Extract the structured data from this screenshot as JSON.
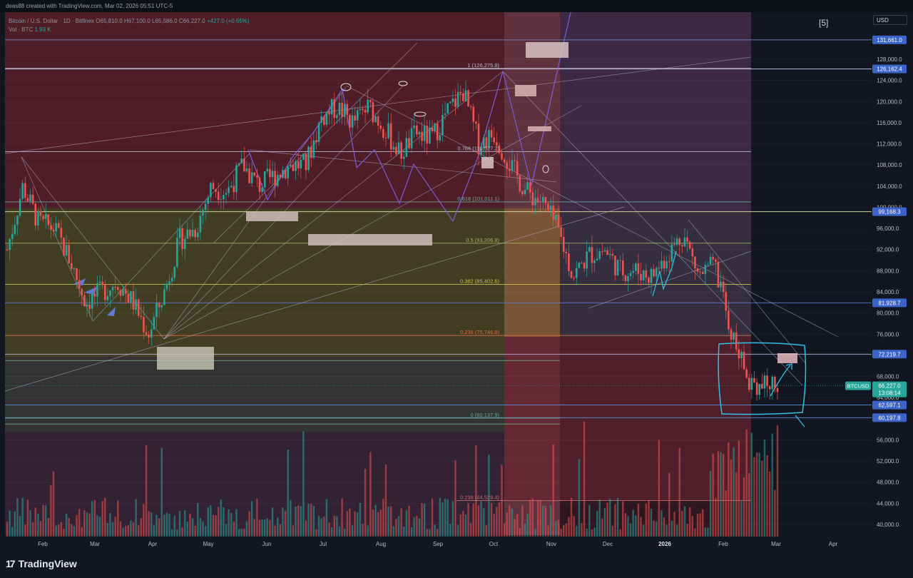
{
  "header": {
    "created_by": "deas88 created with TradingView.com, Mar 02, 2026 05:51 UTC-5"
  },
  "legend": {
    "symbol": "Bitcoin / U.S. Dollar · 1D · Bitfinex",
    "ohlc": "O65,810.0  H67,100.0  L65,586.0  C66,227.0",
    "change": "+427.0 (+0.65%)",
    "vol_label": "Vol · BTC",
    "vol_value": "1.93 K"
  },
  "badge": "[5]",
  "currency": "USD",
  "brand": {
    "icon": "tradingview-logo-icon",
    "name": "TradingView"
  },
  "colors": {
    "up": "#26a69a",
    "down": "#ef5350",
    "accent": "#2962ff",
    "price_badge": "#26a69a"
  },
  "chart_data": {
    "type": "candlestick",
    "symbol": "BTCUSD",
    "x_ticks": [
      "Feb",
      "Mar",
      "Apr",
      "May",
      "Jun",
      "Jul",
      "Aug",
      "Sep",
      "Oct",
      "Nov",
      "Dec",
      "2026",
      "Feb",
      "Mar",
      "Apr"
    ],
    "y_ticks": [
      128000,
      124000,
      120000,
      116000,
      112000,
      108000,
      104000,
      100000,
      96000,
      92000,
      88000,
      84000,
      80000,
      76000,
      72000,
      68000,
      64000,
      60000,
      56000,
      52000,
      48000,
      44000,
      40000
    ],
    "y_tick_labels": [
      "128,000.0",
      "124,000.0",
      "120,000.0",
      "116,000.0",
      "112,000.0",
      "108,000.0",
      "104,000.0",
      "100,000.0",
      "96,000.0",
      "92,000.0",
      "88,000.0",
      "84,000.0",
      "80,000.0",
      "76,000.0",
      "72,000.0",
      "68,000.0",
      "64,000.0",
      "60,000.0",
      "56,000.0",
      "52,000.0",
      "48,000.0",
      "44,000.0",
      "40,000.0"
    ],
    "price_badges": [
      {
        "label": "131,661.0",
        "value": 131661
      },
      {
        "label": "126,162.4",
        "value": 126162
      },
      {
        "label": "99,168.3",
        "value": 99168
      },
      {
        "label": "81,928.7",
        "value": 81929
      },
      {
        "label": "72,219.7",
        "value": 72220
      },
      {
        "label": "62,597.1",
        "value": 62597
      },
      {
        "label": "60,197.8",
        "value": 60198
      }
    ],
    "current": {
      "symbol": "BTCUSD",
      "price": "66,227.0",
      "countdown": "13:08:14",
      "value": 66227
    },
    "fib_levels": [
      {
        "label": "1 (126,275.8)",
        "value": 126276
      },
      {
        "label": "0.786 (110,527.2)",
        "value": 110527
      },
      {
        "label": "0.618 (101,011.1)",
        "value": 101011
      },
      {
        "label": "0.5 (93,206.8)",
        "value": 93207
      },
      {
        "label": "0.382 (85,402.6)",
        "value": 85403
      },
      {
        "label": "0.236 (75,746.8)",
        "value": 75747
      },
      {
        "label": "0 (60,137.9)",
        "value": 60138
      },
      {
        "label": "0.236 (44,529.4)",
        "value": 44529
      }
    ],
    "price_path": [
      [
        0,
        92000
      ],
      [
        1,
        104000
      ],
      [
        2,
        97000
      ],
      [
        3,
        96000
      ],
      [
        4,
        90000
      ],
      [
        5,
        82000
      ],
      [
        6,
        84000
      ],
      [
        7,
        86000
      ],
      [
        8,
        82000
      ],
      [
        9,
        76000
      ],
      [
        10,
        84000
      ],
      [
        11,
        94000
      ],
      [
        12,
        96000
      ],
      [
        13,
        104000
      ],
      [
        14,
        103000
      ],
      [
        15,
        108000
      ],
      [
        16,
        104000
      ],
      [
        17,
        106000
      ],
      [
        18,
        108000
      ],
      [
        19,
        108000
      ],
      [
        20,
        117000
      ],
      [
        21,
        119000
      ],
      [
        22,
        116000
      ],
      [
        23,
        119000
      ],
      [
        24,
        115000
      ],
      [
        25,
        110000
      ],
      [
        26,
        114000
      ],
      [
        27,
        113000
      ],
      [
        28,
        118000
      ],
      [
        29,
        122000
      ],
      [
        30,
        112000
      ],
      [
        31,
        114000
      ],
      [
        32,
        108000
      ],
      [
        33,
        103000
      ],
      [
        34,
        101000
      ],
      [
        35,
        96000
      ],
      [
        36,
        87000
      ],
      [
        37,
        91000
      ],
      [
        38,
        92000
      ],
      [
        39,
        88000
      ],
      [
        40,
        88000
      ],
      [
        41,
        87000
      ],
      [
        42,
        91000
      ],
      [
        43,
        95000
      ],
      [
        44,
        87000
      ],
      [
        45,
        89000
      ],
      [
        46,
        77000
      ],
      [
        47,
        68000
      ],
      [
        48,
        66000
      ],
      [
        49,
        67000
      ]
    ]
  }
}
